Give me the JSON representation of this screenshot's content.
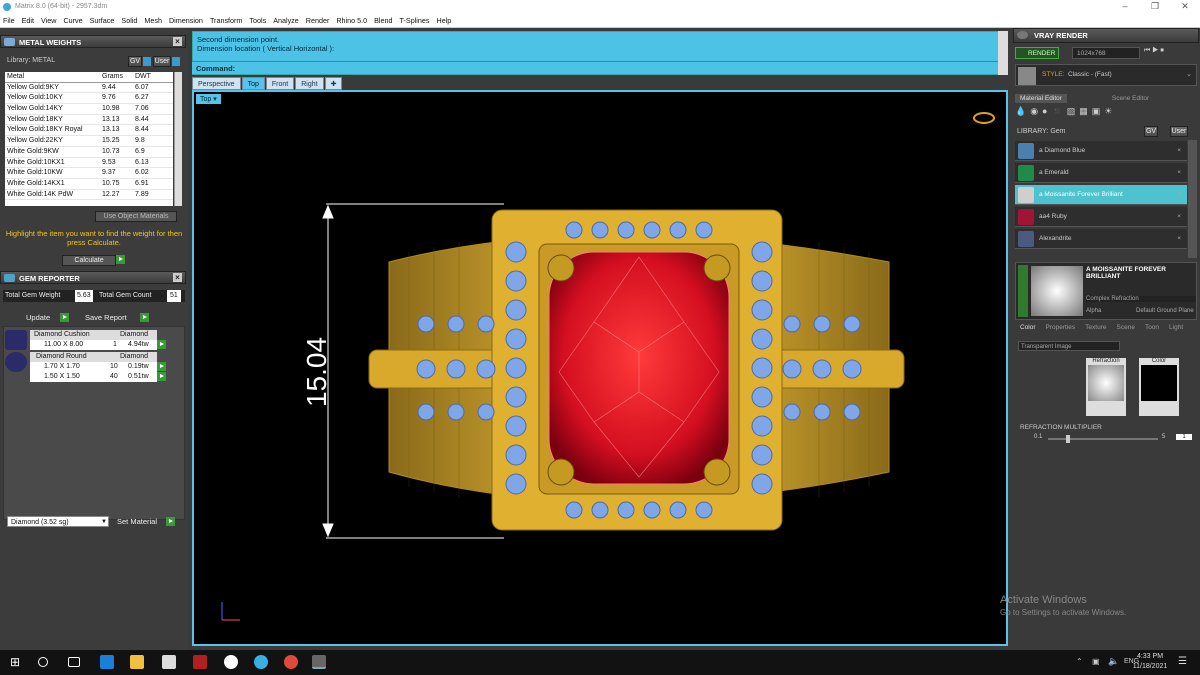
{
  "window": {
    "title": "Matrix 8.0 (64-bit) - 2957.3dm"
  },
  "menu": [
    "File",
    "Edit",
    "View",
    "Curve",
    "Surface",
    "Solid",
    "Mesh",
    "Dimension",
    "Transform",
    "Tools",
    "Analyze",
    "Render",
    "Rhino 5.0",
    "Blend",
    "T-Splines",
    "Help"
  ],
  "metal_weights": {
    "title": "METAL WEIGHTS",
    "library_label": "Library: METAL",
    "gv": "GV",
    "user": "User",
    "columns": [
      "Metal",
      "Grams",
      "DWT"
    ],
    "rows": [
      [
        "Yellow Gold:9KY",
        "9.44",
        "6.07"
      ],
      [
        "Yellow Gold:10KY",
        "9.76",
        "6.27"
      ],
      [
        "Yellow Gold:14KY",
        "10.98",
        "7.06"
      ],
      [
        "Yellow Gold:18KY",
        "13.13",
        "8.44"
      ],
      [
        "Yellow Gold:18KY Royal",
        "13.13",
        "8.44"
      ],
      [
        "Yellow Gold:22KY",
        "15.25",
        "9.8"
      ],
      [
        "White Gold:9KW",
        "10.73",
        "6.9"
      ],
      [
        "White Gold:10KX1",
        "9.53",
        "6.13"
      ],
      [
        "White Gold:10KW",
        "9.37",
        "6.02"
      ],
      [
        "White Gold:14KX1",
        "10.75",
        "6.91"
      ],
      [
        "White Gold:14K PdW",
        "12.27",
        "7.89"
      ]
    ],
    "use_object_label": "Use Object Materials",
    "hint": "Highlight the item you want to find the weight for then press Calculate.",
    "calculate": "Calculate"
  },
  "gem_reporter": {
    "title": "GEM REPORTER",
    "total_weight_label": "Total Gem Weight",
    "total_weight": "5.63",
    "total_count_label": "Total Gem Count",
    "total_count": "51",
    "update": "Update",
    "save_report": "Save Report",
    "groups": [
      {
        "name": "Diamond Cushion",
        "material": "Diamond",
        "rows": [
          [
            "11.00 X 8.00",
            "1",
            "4.94tw"
          ]
        ]
      },
      {
        "name": "Diamond Round",
        "material": "Diamond",
        "rows": [
          [
            "1.70 X 1.70",
            "10",
            "0.19tw"
          ],
          [
            "1.50 X 1.50",
            "40",
            "0.51tw"
          ]
        ]
      }
    ],
    "material_select": "Diamond    (3.52 sg)",
    "set_material": "Set Material"
  },
  "command": {
    "line1": "Second dimension point.",
    "line2": "Dimension location ( Vertical  Horizontal ):",
    "prompt": "Command:"
  },
  "viewport_tabs": [
    "Perspective",
    "Top",
    "Front",
    "Right"
  ],
  "viewport_label": "Top",
  "dimension_text": "15.04",
  "vray": {
    "title": "VRAY RENDER",
    "render_btn": "RENDER",
    "resolution": "1024x768",
    "style_label": "STYLE:",
    "style_value": "Classic - (Fast)",
    "tabs": [
      "Material Editor",
      "Scene Editor"
    ],
    "library_label": "LIBRARY: Gem",
    "gems": [
      {
        "name": "a Diamond Blue",
        "color": "#4a7fb0"
      },
      {
        "name": "a Emerald",
        "color": "#1f8a4a"
      },
      {
        "name": "a Moissanite Forever Brilliant",
        "color": "#cfcfcf"
      },
      {
        "name": "aa4 Ruby",
        "color": "#a01535"
      },
      {
        "name": "Alexandrite",
        "color": "#4a5a80"
      }
    ],
    "selected_name": "A MOISSANITE FOREVER BRILLIANT",
    "complex_refraction": "Complex Refraction",
    "alpha": "Alpha",
    "ground_plane": "Default Ground Plane",
    "subtabs": [
      "Color",
      "Properties",
      "Texture",
      "Scene",
      "Toon",
      "Light"
    ],
    "transparent": "Transparent Image",
    "refraction": "Refraction",
    "color": "Color",
    "multiplier_label": "REFRACTION MULTIPLIER",
    "mult_min": "0.1",
    "mult_max": "5",
    "mult_val": "1"
  },
  "watermark": {
    "line1": "Activate Windows",
    "line2": "Go to Settings to activate Windows."
  },
  "taskbar": {
    "lang": "ENG",
    "time": "4:33 PM",
    "date": "11/18/2021"
  }
}
